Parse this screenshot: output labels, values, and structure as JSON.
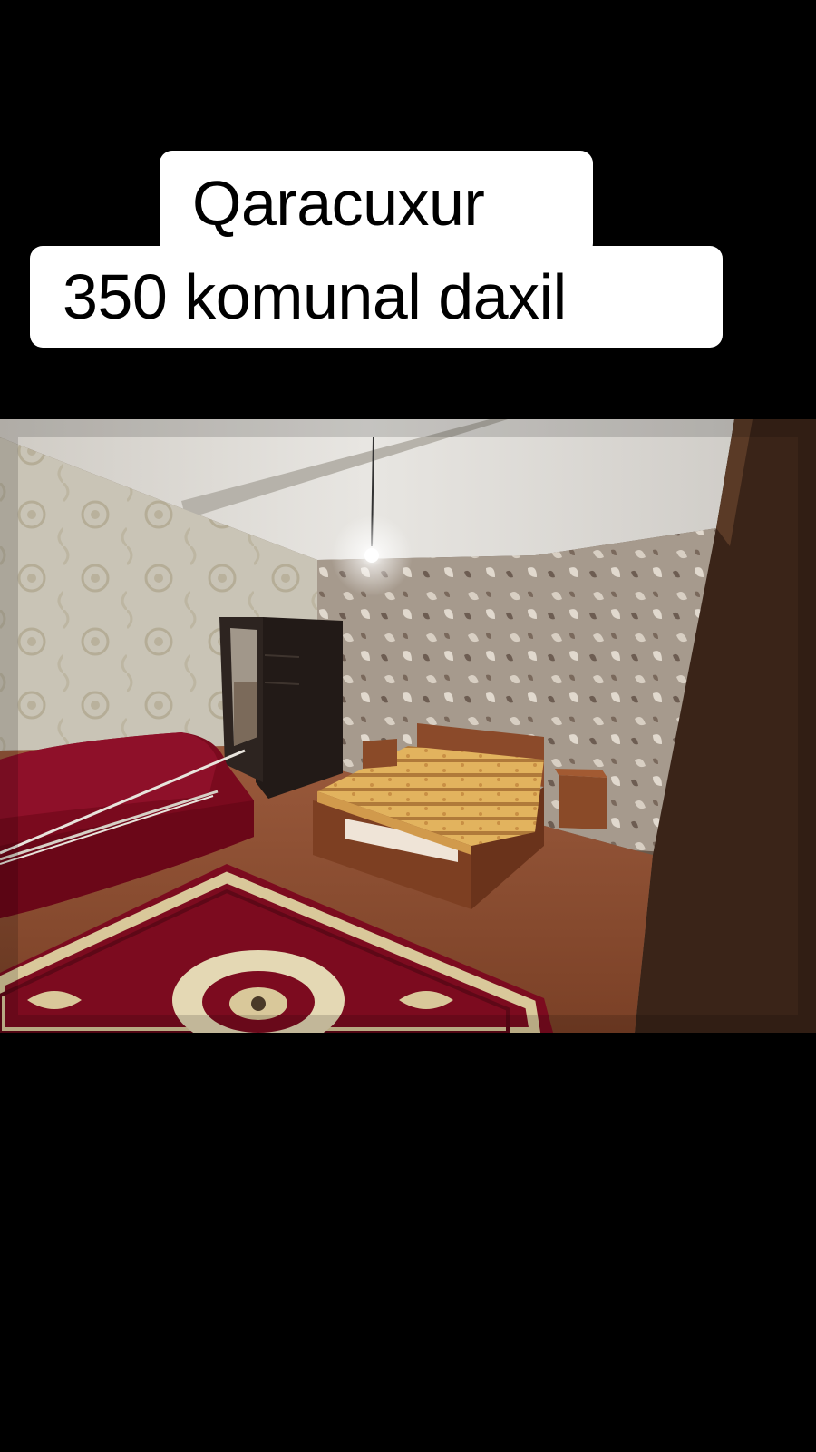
{
  "caption": {
    "line1": "Qaracuxur",
    "line2": "350 komunal daxil"
  },
  "colors": {
    "background": "#000000",
    "caption_background": "#ffffff",
    "caption_text": "#000000"
  },
  "photo": {
    "subject": "furnished bedroom",
    "elements": [
      "wallpapered walls",
      "ceiling light bulb",
      "double bed",
      "red sofa",
      "red patterned carpet",
      "dark wardrobe with mirror",
      "bedside cabinets"
    ]
  }
}
